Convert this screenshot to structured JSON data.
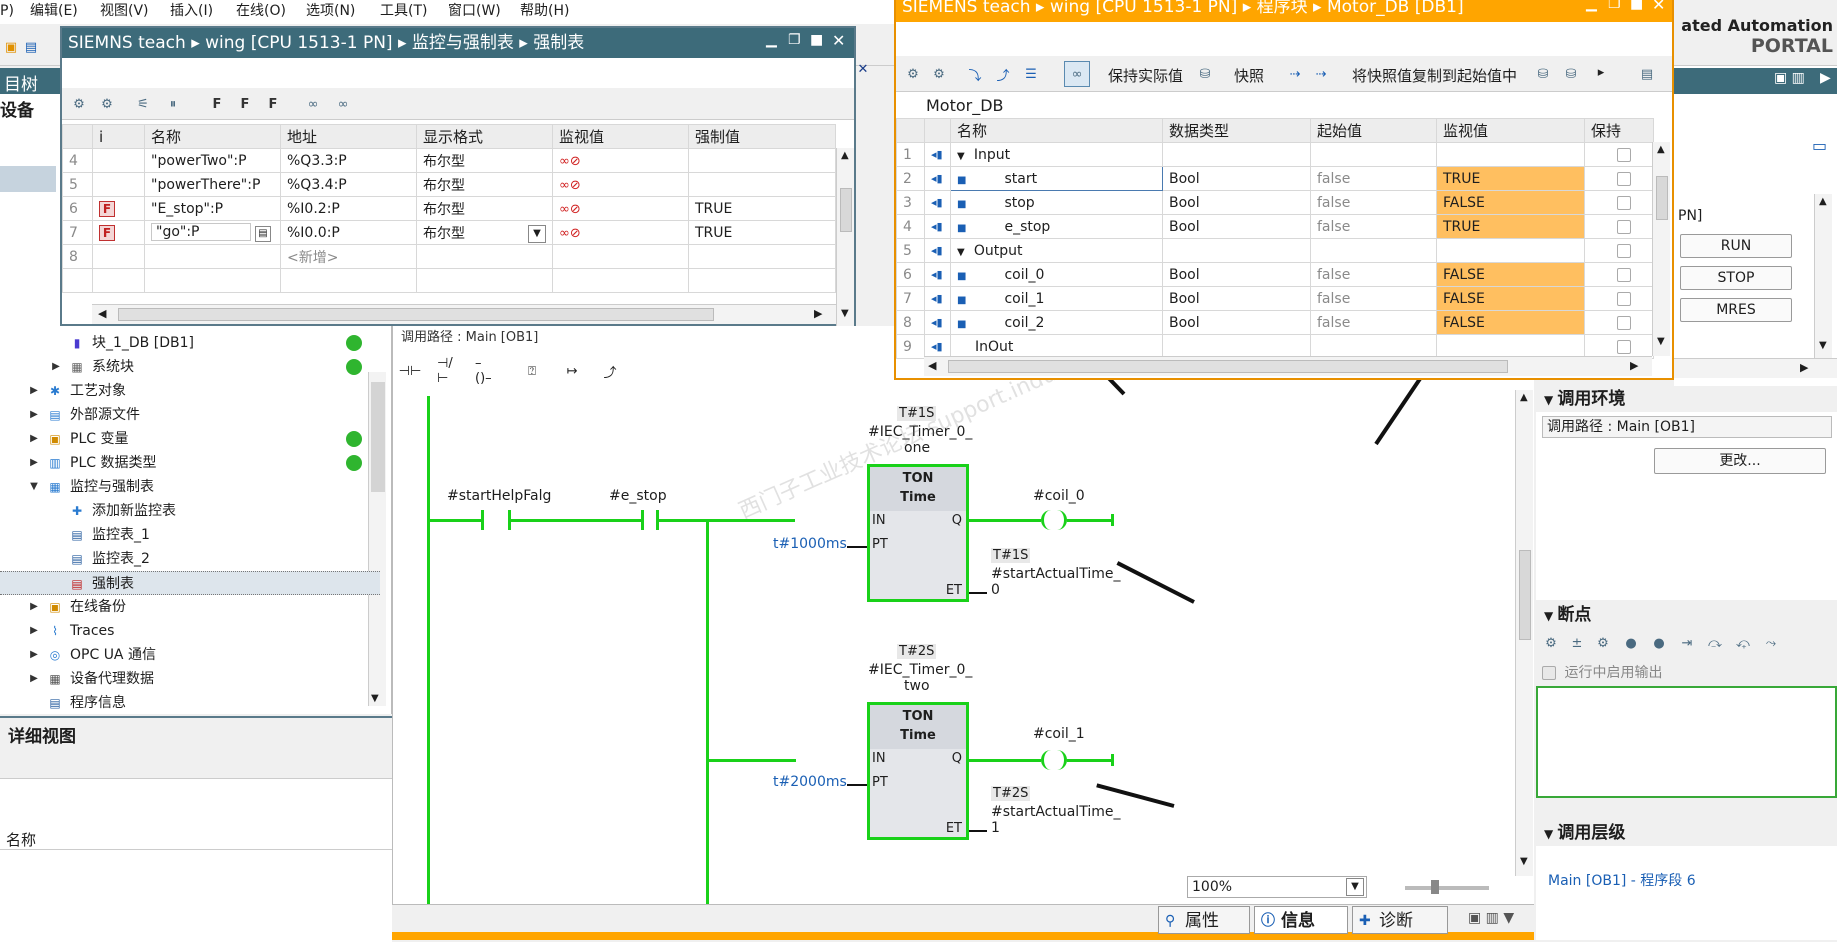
{
  "menubar": [
    "P)",
    "编辑(E)",
    "视图(V)",
    "插入(I)",
    "在线(O)",
    "选项(N)",
    "工具(T)",
    "窗口(W)",
    "帮助(H)"
  ],
  "portal": {
    "line1": "ated Automation",
    "line2": "PORTAL"
  },
  "project_tree": {
    "title": "目树",
    "devices_label": "设备",
    "items": [
      {
        "label": "块_1_DB [DB1]",
        "status": true
      },
      {
        "label": "系统块",
        "status": true
      },
      {
        "label": "工艺对象",
        "status": false
      },
      {
        "label": "外部源文件",
        "status": false
      },
      {
        "label": "PLC 变量",
        "status": true
      },
      {
        "label": "PLC 数据类型",
        "status": true
      },
      {
        "label": "监控与强制表",
        "status": false
      },
      {
        "label": "添加新监控表",
        "status": false
      },
      {
        "label": "监控表_1",
        "status": false
      },
      {
        "label": "监控表_2",
        "status": false
      },
      {
        "label": "强制表",
        "status": false
      },
      {
        "label": "在线备份",
        "status": false
      },
      {
        "label": "Traces",
        "status": false
      },
      {
        "label": "OPC UA 通信",
        "status": false
      },
      {
        "label": "设备代理数据",
        "status": false
      },
      {
        "label": "程序信息",
        "status": false
      }
    ]
  },
  "detail_view": {
    "title": "详细视图",
    "col_name": "名称"
  },
  "force_table": {
    "title": "SIEMNS teach  ▸  wing [CPU 1513-1 PN]  ▸  监控与强制表  ▸  强制表",
    "headers": [
      "i",
      "名称",
      "地址",
      "显示格式",
      "监视值",
      "强制值"
    ],
    "rows": [
      {
        "n": "4",
        "f": "",
        "name": "\"powerTwo\":P",
        "addr": "%Q3.3:P",
        "fmt": "布尔型",
        "force": ""
      },
      {
        "n": "5",
        "f": "",
        "name": "\"powerThere\":P",
        "addr": "%Q3.4:P",
        "fmt": "布尔型",
        "force": ""
      },
      {
        "n": "6",
        "f": "F",
        "name": "\"E_stop\":P",
        "addr": "%I0.2:P",
        "fmt": "布尔型",
        "force": "TRUE"
      },
      {
        "n": "7",
        "f": "F",
        "name": "\"go\":P",
        "addr": "%I0.0:P",
        "fmt": "布尔型",
        "force": "TRUE"
      },
      {
        "n": "8",
        "f": "",
        "name": "",
        "addr": "<新增>",
        "fmt": "",
        "force": ""
      }
    ]
  },
  "db_window": {
    "title": "SIEMENS teach  ▸  wing [CPU 1513-1 PN]  ▸  程序块  ▸  Motor_DB [DB1]",
    "toolbar": {
      "keep": "保持实际值",
      "snapshot": "快照",
      "copy": "将快照值复制到起始值中"
    },
    "db_name": "Motor_DB",
    "headers": [
      "名称",
      "数据类型",
      "起始值",
      "监视值",
      "保持"
    ],
    "rows": [
      {
        "n": "1",
        "name": "Input",
        "group": true,
        "type": "",
        "start": "",
        "mon": ""
      },
      {
        "n": "2",
        "name": "start",
        "group": false,
        "type": "Bool",
        "start": "false",
        "mon": "TRUE"
      },
      {
        "n": "3",
        "name": "stop",
        "group": false,
        "type": "Bool",
        "start": "false",
        "mon": "FALSE"
      },
      {
        "n": "4",
        "name": "e_stop",
        "group": false,
        "type": "Bool",
        "start": "false",
        "mon": "TRUE"
      },
      {
        "n": "5",
        "name": "Output",
        "group": true,
        "type": "",
        "start": "",
        "mon": ""
      },
      {
        "n": "6",
        "name": "coil_0",
        "group": false,
        "type": "Bool",
        "start": "false",
        "mon": "FALSE"
      },
      {
        "n": "7",
        "name": "coil_1",
        "group": false,
        "type": "Bool",
        "start": "false",
        "mon": "FALSE"
      },
      {
        "n": "8",
        "name": "coil_2",
        "group": false,
        "type": "Bool",
        "start": "false",
        "mon": "FALSE"
      },
      {
        "n": "9",
        "name": "InOut",
        "group": false,
        "type": "",
        "start": "",
        "mon": ""
      }
    ]
  },
  "editor": {
    "call_path": "调用路径 : Main [OB1]",
    "zoom": "100%",
    "network1": {
      "contact1": "#startHelpFalg",
      "contact2": "#e_stop",
      "timer_val": "T#1S",
      "instance1": "#IEC_Timer_0_",
      "instance2": "one",
      "box_title": "TON",
      "box_sub": "Time",
      "pt": "t#1000ms",
      "coil": "#coil_0",
      "et_val": "T#1S",
      "et1": "#startActualTime_",
      "et2": "0"
    },
    "network2": {
      "timer_val": "T#2S",
      "instance1": "#IEC_Timer_0_",
      "instance2": "two",
      "box_title": "TON",
      "box_sub": "Time",
      "pt": "t#2000ms",
      "coil": "#coil_1",
      "et_val": "T#2S",
      "et1": "#startActualTime_",
      "et2": "1"
    },
    "pins": {
      "in": "IN",
      "pt": "PT",
      "q": "Q",
      "et": "ET"
    },
    "watermark": "西门子工业技术论坛 support.industry.siemens.com/cs"
  },
  "online_panel": {
    "cpu": "PN]",
    "run": "RUN",
    "stop": "STOP",
    "mres": "MRES"
  },
  "call_env": {
    "title": "调用环境",
    "path": "调用路径 : Main [OB1]",
    "change": "更改..."
  },
  "breakpoints": {
    "title": "断点",
    "enable_output": "运行中启用输出"
  },
  "call_hierarchy": {
    "title": "调用层级",
    "link": "Main [OB1] - 程序段 6"
  },
  "bottom_tabs": {
    "properties": "属性",
    "info": "信息",
    "diagnostics": "诊断"
  },
  "colors": {
    "accent_orange": "#ffa500",
    "green": "#19d119",
    "teal": "#3d6b7a",
    "monitor": "#ffbf60"
  }
}
